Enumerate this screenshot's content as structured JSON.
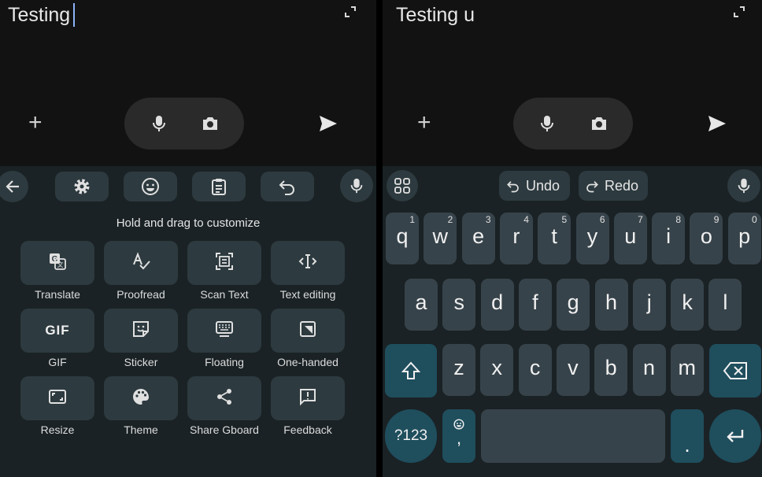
{
  "left": {
    "input_text": "Testing",
    "toolbar_icons": [
      "back-arrow-icon",
      "settings-icon",
      "emoji-icon",
      "clipboard-icon",
      "undo-icon",
      "microphone-icon"
    ],
    "hint": "Hold and drag to customize",
    "tiles": [
      {
        "label": "Translate",
        "icon": "translate-icon"
      },
      {
        "label": "Proofread",
        "icon": "proofread-icon"
      },
      {
        "label": "Scan Text",
        "icon": "scan-text-icon"
      },
      {
        "label": "Text editing",
        "icon": "text-editing-icon"
      },
      {
        "label": "GIF",
        "icon": "gif-icon",
        "glyph": "GIF"
      },
      {
        "label": "Sticker",
        "icon": "sticker-icon"
      },
      {
        "label": "Floating",
        "icon": "floating-keyboard-icon"
      },
      {
        "label": "One-handed",
        "icon": "one-handed-icon"
      },
      {
        "label": "Resize",
        "icon": "resize-icon"
      },
      {
        "label": "Theme",
        "icon": "palette-icon"
      },
      {
        "label": "Share Gboard",
        "icon": "share-icon"
      },
      {
        "label": "Feedback",
        "icon": "feedback-icon"
      }
    ]
  },
  "right": {
    "input_text": "Testing u",
    "undo_label": "Undo",
    "redo_label": "Redo",
    "row1": [
      {
        "k": "q",
        "n": "1"
      },
      {
        "k": "w",
        "n": "2"
      },
      {
        "k": "e",
        "n": "3"
      },
      {
        "k": "r",
        "n": "4"
      },
      {
        "k": "t",
        "n": "5"
      },
      {
        "k": "y",
        "n": "6"
      },
      {
        "k": "u",
        "n": "7"
      },
      {
        "k": "i",
        "n": "8"
      },
      {
        "k": "o",
        "n": "9"
      },
      {
        "k": "p",
        "n": "0"
      }
    ],
    "row2": [
      "a",
      "s",
      "d",
      "f",
      "g",
      "h",
      "j",
      "k",
      "l"
    ],
    "row3": [
      "z",
      "x",
      "c",
      "v",
      "b",
      "n",
      "m"
    ],
    "symbols_label": "?123",
    "comma_label": ",",
    "period_label": "."
  },
  "colors": {
    "accent_teal": "#1f4e5d",
    "key": "#37434a",
    "keyboard_bg": "#1a2225"
  }
}
